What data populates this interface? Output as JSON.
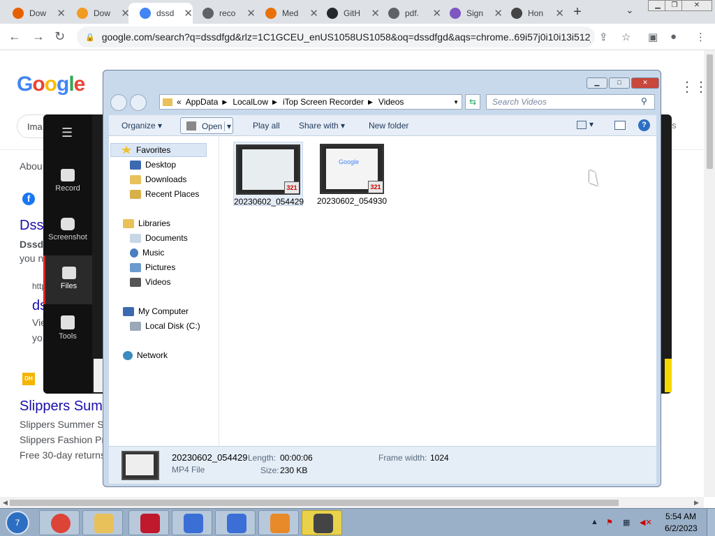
{
  "chrome": {
    "tabs": [
      {
        "title": "Dow",
        "favicon_color": "#e66000"
      },
      {
        "title": "Dow",
        "favicon_color": "#f29b21"
      },
      {
        "title": "dssd",
        "favicon_color": "#4285f4"
      },
      {
        "title": "reco",
        "favicon_color": "#5f6368"
      },
      {
        "title": "Med",
        "favicon_color": "#e8710a"
      },
      {
        "title": "GitH",
        "favicon_color": "#24292f"
      },
      {
        "title": "pdf.",
        "favicon_color": "#5f6368"
      },
      {
        "title": "Sign",
        "favicon_color": "#7e57c2"
      },
      {
        "title": "Hon",
        "favicon_color": "#444444"
      }
    ],
    "active_tab": 2,
    "new_tab_label": "+",
    "url": "google.com/search?q=dssdfgd&rlz=1C1GCEU_enUS1058US1058&oq=dssdfgd&aqs=chrome..69i57j0i10i13i512j..."
  },
  "google": {
    "logo": "Google",
    "chip": "Ima",
    "tools_peek": "ols",
    "about": "Abou",
    "result1_title": "Dss",
    "result1_snippet1": "Dssd",
    "result1_snippet2": "you n",
    "result2_url": "http",
    "result2_title": "ds",
    "result2_snippet1": "Vie",
    "result2_snippet2": "yo",
    "result3_badge": "DH",
    "result3_title": "Slippers Sum",
    "result3_snippet1": "Slippers Summer S",
    "result3_snippet2": "Slippers Fashion Pr",
    "result3_snippet3": "Free 30-day returns"
  },
  "itop": {
    "nav": [
      {
        "label": "Record"
      },
      {
        "label": "Screenshot"
      },
      {
        "label": "Files"
      },
      {
        "label": "Tools"
      }
    ],
    "active": "Files"
  },
  "explorer": {
    "breadcrumb": [
      "AppData",
      "LocalLow",
      "iTop Screen Recorder",
      "Videos"
    ],
    "search_placeholder": "Search Videos",
    "commands": {
      "organize": "Organize",
      "open": "Open",
      "play_all": "Play all",
      "share_with": "Share with",
      "new_folder": "New folder"
    },
    "nav_pane": {
      "favorites": "Favorites",
      "desktop": "Desktop",
      "downloads": "Downloads",
      "recent_places": "Recent Places",
      "libraries": "Libraries",
      "documents": "Documents",
      "music": "Music",
      "pictures": "Pictures",
      "videos": "Videos",
      "my_computer": "My Computer",
      "local_disk": "Local Disk (C:)",
      "network": "Network"
    },
    "files": [
      {
        "name": "20230602_054429",
        "selected": true
      },
      {
        "name": "20230602_054930",
        "selected": false
      }
    ],
    "thumb_badge": "321",
    "thumb_google_text": "Google",
    "details": {
      "name": "20230602_054429",
      "type": "MP4 File",
      "length_label": "Length:",
      "length_value": "00:00:06",
      "size_label": "Size:",
      "size_value": "230 KB",
      "frame_width_label": "Frame width:",
      "frame_width_value": "1024"
    }
  },
  "taskbar": {
    "start_label": "7",
    "apps": [
      {
        "name": "Chrome",
        "color": "#db4437"
      },
      {
        "name": "Explorer",
        "color": "#e8c15a"
      },
      {
        "name": "iTop Screen Recorder",
        "color": "#c0182c"
      },
      {
        "name": "P app 1",
        "color": "#3b6fd6"
      },
      {
        "name": "P app 2",
        "color": "#3b6fd6"
      },
      {
        "name": "Video app",
        "color": "#e88a2a"
      },
      {
        "name": "Media Player Classic",
        "color": "#444444"
      }
    ],
    "time": "5:54 AM",
    "date": "6/2/2023"
  }
}
